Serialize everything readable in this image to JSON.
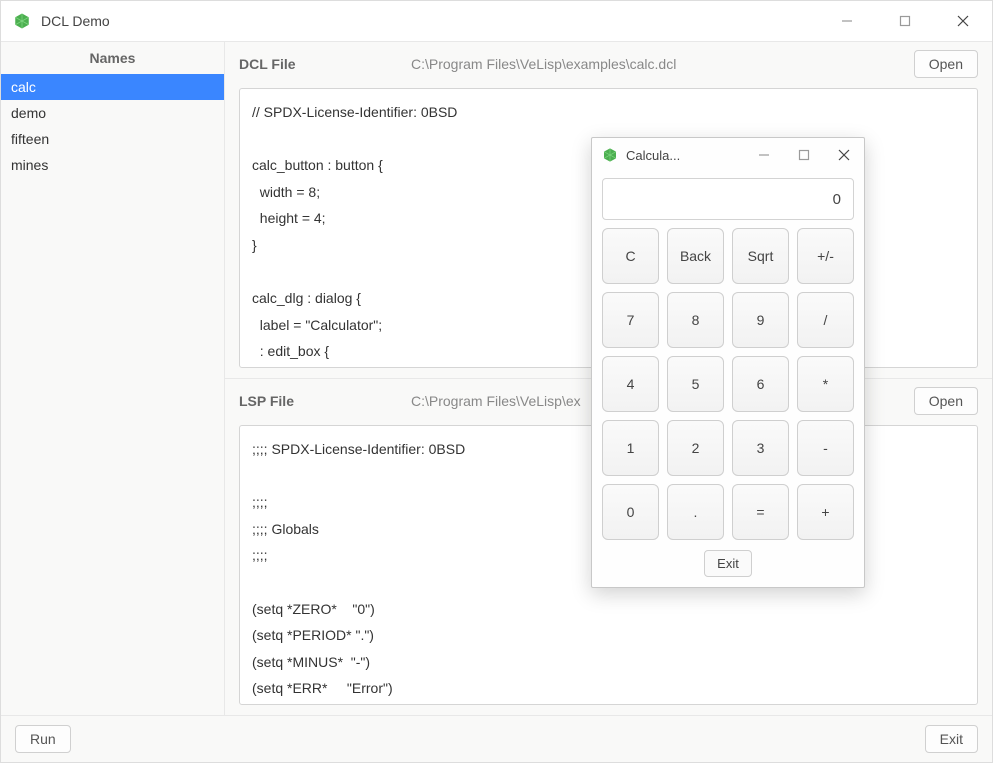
{
  "window": {
    "title": "DCL Demo"
  },
  "sidebar": {
    "header": "Names",
    "items": [
      "calc",
      "demo",
      "fifteen",
      "mines"
    ],
    "selected_index": 0
  },
  "dcl": {
    "label": "DCL File",
    "path": "C:\\Program Files\\VeLisp\\examples\\calc.dcl",
    "open_label": "Open",
    "content": "// SPDX-License-Identifier: 0BSD\n\ncalc_button : button {\n  width = 8;\n  height = 4;\n}\n\ncalc_dlg : dialog {\n  label = \"Calculator\";\n  : edit_box {"
  },
  "lsp": {
    "label": "LSP File",
    "path": "C:\\Program Files\\VeLisp\\ex",
    "open_label": "Open",
    "content": ";;;; SPDX-License-Identifier: 0BSD\n\n;;;;\n;;;; Globals\n;;;;\n\n(setq *ZERO*    \"0\")\n(setq *PERIOD* \".\")\n(setq *MINUS*  \"-\")\n(setq *ERR*     \"Error\")"
  },
  "footer": {
    "run_label": "Run",
    "exit_label": "Exit"
  },
  "calc": {
    "title": "Calcula...",
    "display": "0",
    "exit_label": "Exit",
    "buttons": [
      "C",
      "Back",
      "Sqrt",
      "+/-",
      "7",
      "8",
      "9",
      "/",
      "4",
      "5",
      "6",
      "*",
      "1",
      "2",
      "3",
      "-",
      "0",
      ".",
      "=",
      "+"
    ]
  }
}
